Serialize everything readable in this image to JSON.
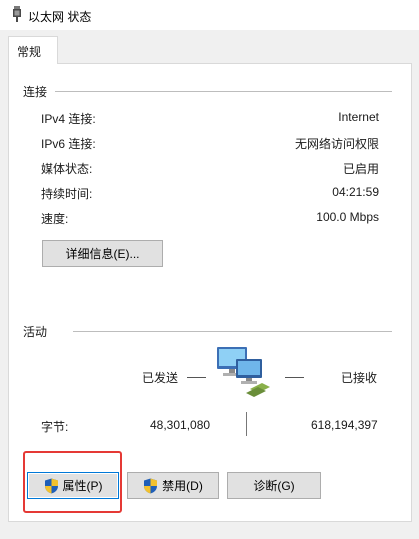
{
  "window": {
    "title": "以太网 状态"
  },
  "tabs": [
    {
      "label": "常规"
    }
  ],
  "connection": {
    "section_label": "连接",
    "rows": [
      {
        "label": "IPv4 连接:",
        "value": "Internet"
      },
      {
        "label": "IPv6 连接:",
        "value": "无网络访问权限"
      },
      {
        "label": "媒体状态:",
        "value": "已启用"
      },
      {
        "label": "持续时间:",
        "value": "04:21:59"
      },
      {
        "label": "速度:",
        "value": "100.0 Mbps"
      }
    ],
    "details_button": "详细信息(E)..."
  },
  "activity": {
    "section_label": "活动",
    "sent_label": "已发送",
    "received_label": "已接收",
    "bytes_label": "字节:",
    "bytes_sent": "48,301,080",
    "bytes_received": "618,194,397"
  },
  "buttons": {
    "properties": "属性(P)",
    "disable": "禁用(D)",
    "diagnose": "诊断(G)"
  },
  "icons": {
    "title": "network-adapter-icon",
    "activity": "network-computers-icon",
    "shield": "uac-shield-icon"
  },
  "colors": {
    "highlight": "#e53935",
    "shield_blue": "#1f5fb8",
    "shield_yellow": "#f2c12e"
  }
}
